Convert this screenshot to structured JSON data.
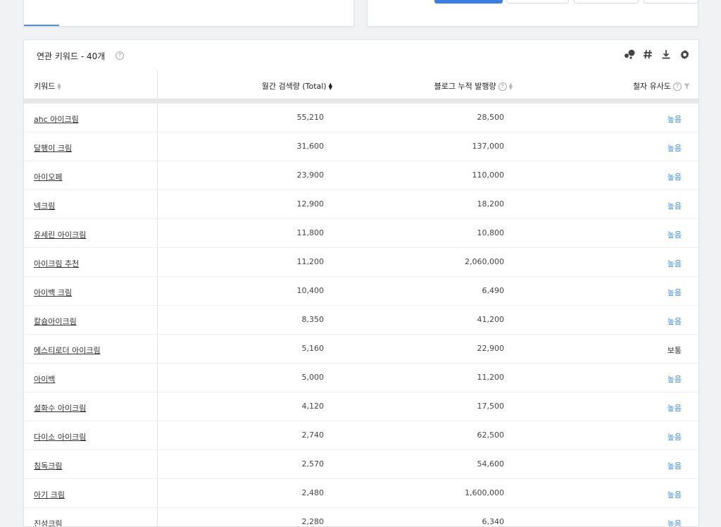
{
  "section": {
    "title": "연관 키워드 - 40개"
  },
  "columns": {
    "keyword": "키워드",
    "monthly_search": "월간 검색량 (Total)",
    "blog_posts": "블로그 누적 발행량",
    "similarity": "철자 유사도"
  },
  "icons": {
    "help": "?"
  },
  "colors": {
    "accent": "#3a7ee0",
    "link_blue": "#3a8ee6"
  },
  "rows": [
    {
      "keyword": "ahc 아이크림",
      "search": "55,210",
      "blog": "28,500",
      "similarity": "높음"
    },
    {
      "keyword": "달팽이 크림",
      "search": "31,600",
      "blog": "137,000",
      "similarity": "높음"
    },
    {
      "keyword": "아이오페",
      "search": "23,900",
      "blog": "110,000",
      "similarity": "높음"
    },
    {
      "keyword": "넥크림",
      "search": "12,900",
      "blog": "18,200",
      "similarity": "높음"
    },
    {
      "keyword": "유세린 아이크림",
      "search": "11,800",
      "blog": "10,800",
      "similarity": "높음"
    },
    {
      "keyword": "아이크림 추천",
      "search": "11,200",
      "blog": "2,060,000",
      "similarity": "높음"
    },
    {
      "keyword": "아이백 크림",
      "search": "10,400",
      "blog": "6,490",
      "similarity": "높음"
    },
    {
      "keyword": "칼슘아이크림",
      "search": "8,350",
      "blog": "41,200",
      "similarity": "높음"
    },
    {
      "keyword": "에스티로더 아이크림",
      "search": "5,160",
      "blog": "22,900",
      "similarity": "보통"
    },
    {
      "keyword": "아이백",
      "search": "5,000",
      "blog": "11,200",
      "similarity": "높음"
    },
    {
      "keyword": "설화수 아이크림",
      "search": "4,120",
      "blog": "17,500",
      "similarity": "높음"
    },
    {
      "keyword": "다이소 아이크림",
      "search": "2,740",
      "blog": "62,500",
      "similarity": "높음"
    },
    {
      "keyword": "침독크림",
      "search": "2,570",
      "blog": "54,600",
      "similarity": "높음"
    },
    {
      "keyword": "아기 크림",
      "search": "2,480",
      "blog": "1,600,000",
      "similarity": "높음"
    },
    {
      "keyword": "진성크림",
      "search": "2,280",
      "blog": "6,340",
      "similarity": "높음"
    }
  ]
}
